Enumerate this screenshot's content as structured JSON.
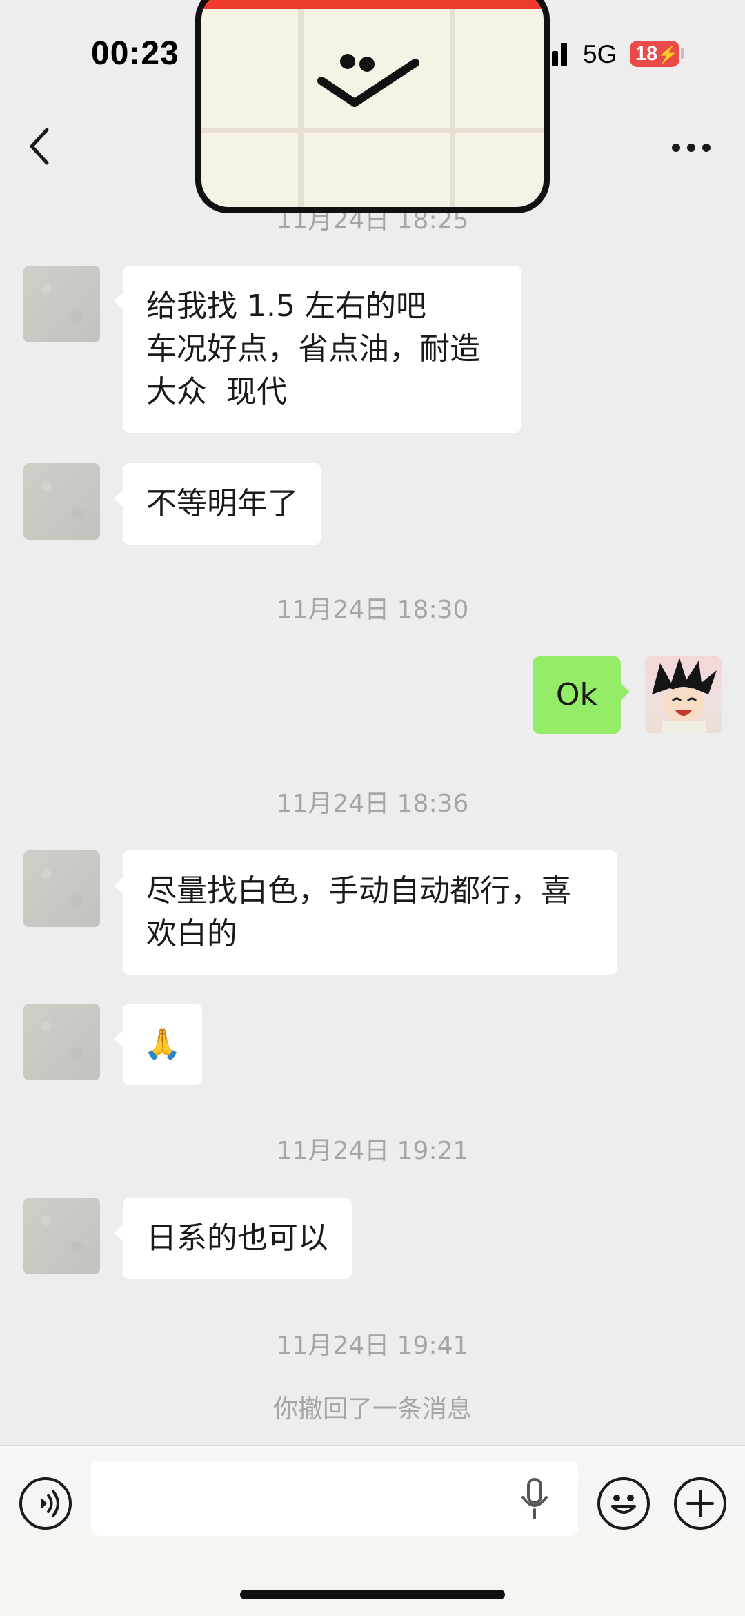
{
  "status_bar": {
    "time": "00:23",
    "network": "5G",
    "battery_level": "18",
    "battery_color": "#ea4a4a"
  },
  "nav": {
    "back_icon": "chevron-left-icon",
    "more_icon": "more-horizontal-icon"
  },
  "chat": {
    "timestamps": [
      "11月24日 18:25",
      "11月24日 18:30",
      "11月24日 18:36",
      "11月24日 19:21",
      "11月24日 19:41"
    ],
    "messages": [
      {
        "from": "other",
        "lines": [
          "给我找 1.5 左右的吧",
          "车况好点，省点油，耐造",
          "大众  现代"
        ]
      },
      {
        "from": "other",
        "lines": [
          "不等明年了"
        ]
      },
      {
        "from": "self",
        "lines": [
          "Ok"
        ]
      },
      {
        "from": "other",
        "lines": [
          "尽量找白色，手动自动都行，喜",
          "欢白的"
        ]
      },
      {
        "from": "other",
        "lines": [
          "🙏"
        ]
      },
      {
        "from": "other",
        "lines": [
          "日系的也可以"
        ]
      }
    ],
    "system_notice": "你撤回了一条消息",
    "self_bubble_color": "#95ec69",
    "other_bubble_color": "#ffffff"
  },
  "input_bar": {
    "value": "",
    "voice_icon": "voice-mode-icon",
    "mic_icon": "microphone-icon",
    "emoji_icon": "emoji-icon",
    "plus_icon": "plus-icon"
  }
}
